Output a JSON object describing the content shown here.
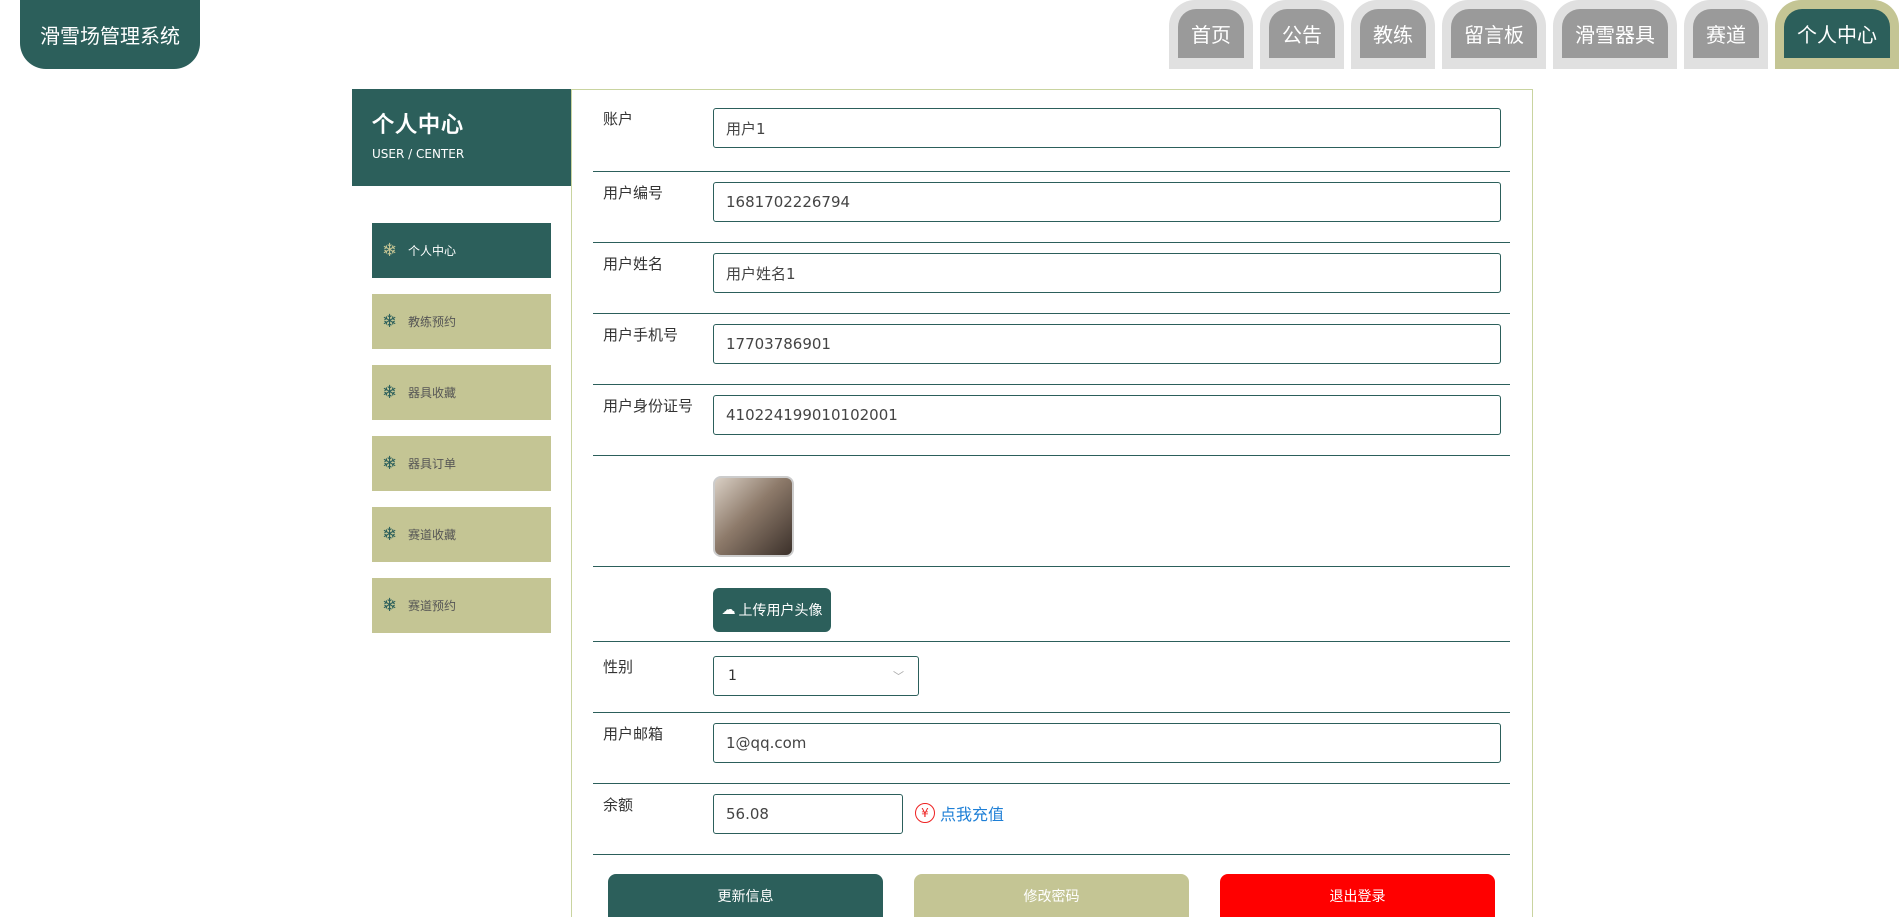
{
  "header": {
    "logo": "滑雪场管理系统",
    "nav": [
      "首页",
      "公告",
      "教练",
      "留言板",
      "滑雪器具",
      "赛道",
      "个人中心"
    ],
    "active_nav": "个人中心"
  },
  "sidebar": {
    "title": "个人中心",
    "subtitle": "USER / CENTER",
    "items": [
      {
        "label": "个人中心",
        "icon": "snowflake-icon",
        "active": true
      },
      {
        "label": "教练预约",
        "icon": "snowflake-icon",
        "active": false
      },
      {
        "label": "器具收藏",
        "icon": "snowflake-icon",
        "active": false
      },
      {
        "label": "器具订单",
        "icon": "snowflake-icon",
        "active": false
      },
      {
        "label": "赛道收藏",
        "icon": "snowflake-icon",
        "active": false
      },
      {
        "label": "赛道预约",
        "icon": "snowflake-icon",
        "active": false
      }
    ]
  },
  "form": {
    "account": {
      "label": "账户",
      "value": "用户1"
    },
    "user_no": {
      "label": "用户编号",
      "value": "1681702226794"
    },
    "user_name": {
      "label": "用户姓名",
      "value": "用户姓名1"
    },
    "phone": {
      "label": "用户手机号",
      "value": "17703786901"
    },
    "id_card": {
      "label": "用户身份证号",
      "value": "410224199010102001"
    },
    "upload_label": "上传用户头像",
    "gender": {
      "label": "性别",
      "value": "1"
    },
    "email": {
      "label": "用户邮箱",
      "value": "1@qq.com"
    },
    "balance": {
      "label": "余额",
      "value": "56.08"
    },
    "recharge_label": "点我充值"
  },
  "buttons": {
    "update": "更新信息",
    "change_password": "修改密码",
    "logout": "退出登录"
  },
  "colors": {
    "primary": "#2c5f5b",
    "olive": "#c4c594",
    "danger": "#ff0000",
    "link": "#1e7fd6"
  }
}
